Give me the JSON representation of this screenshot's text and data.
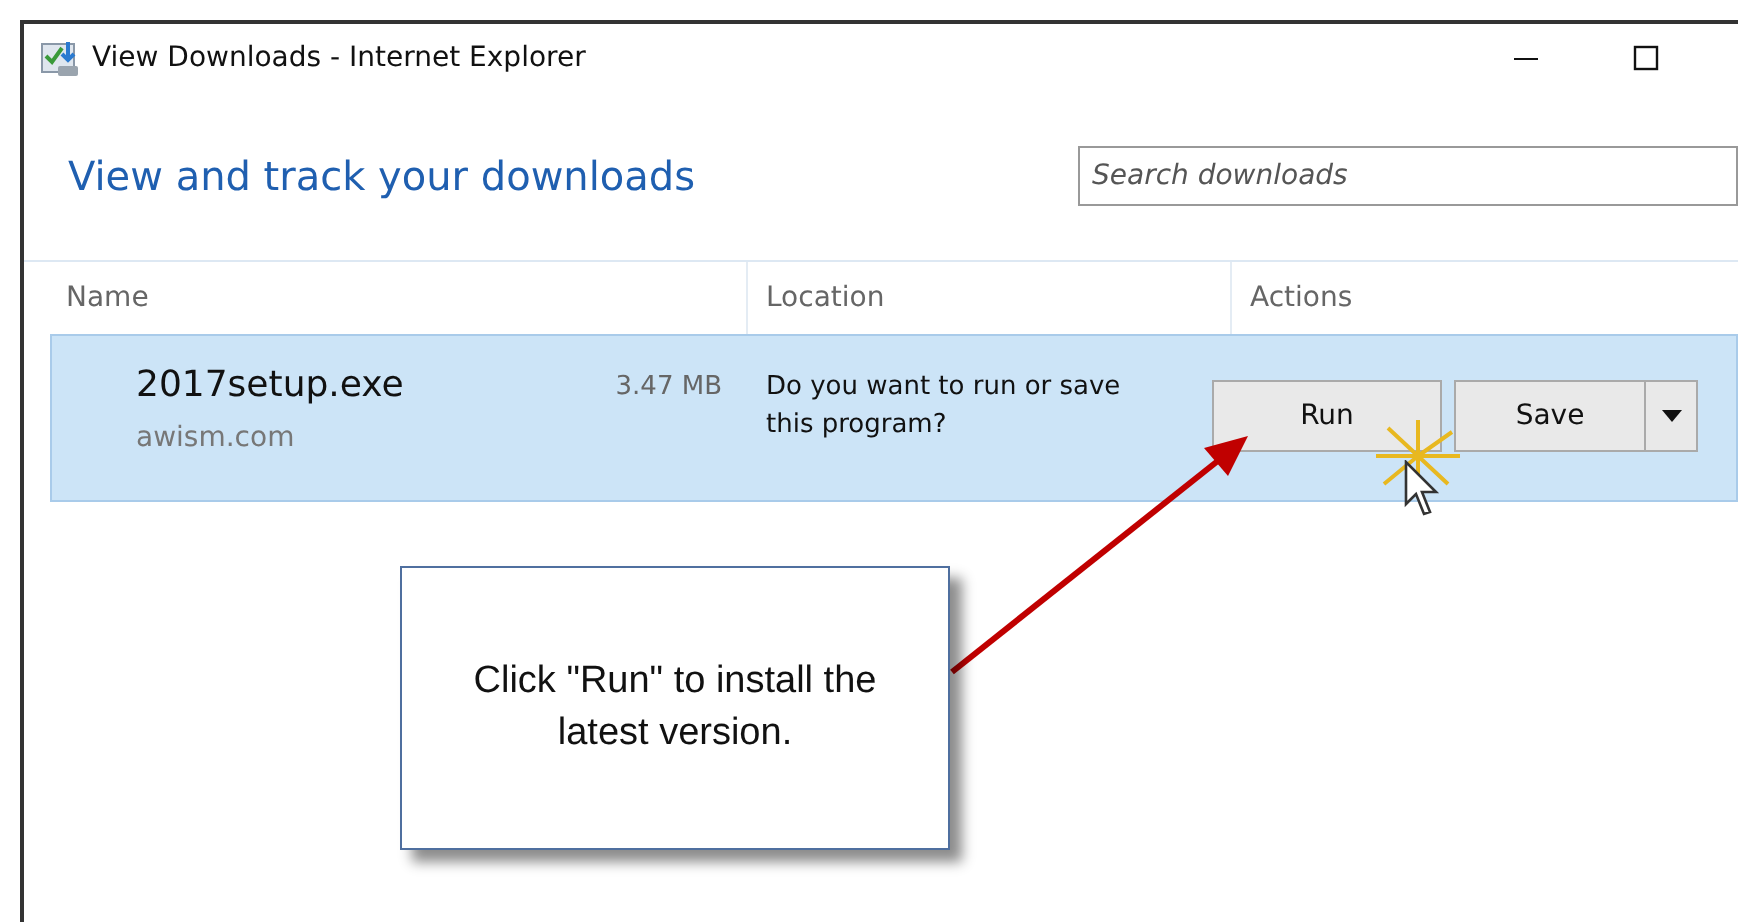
{
  "window": {
    "title": "View Downloads - Internet Explorer"
  },
  "heading": "View and track your downloads",
  "search": {
    "placeholder": "Search downloads"
  },
  "table": {
    "columns": [
      "Name",
      "Location",
      "Actions"
    ],
    "rows": [
      {
        "name": "2017setup.exe",
        "size": "3.47 MB",
        "source": "awism.com",
        "location": "Do you want to run or save this program?",
        "selected": true,
        "actions": [
          {
            "label": "Run",
            "kind": "button"
          },
          {
            "label": "Save",
            "kind": "split"
          }
        ]
      }
    ]
  },
  "callout": {
    "text": "Click \"Run\" to install the latest version."
  }
}
